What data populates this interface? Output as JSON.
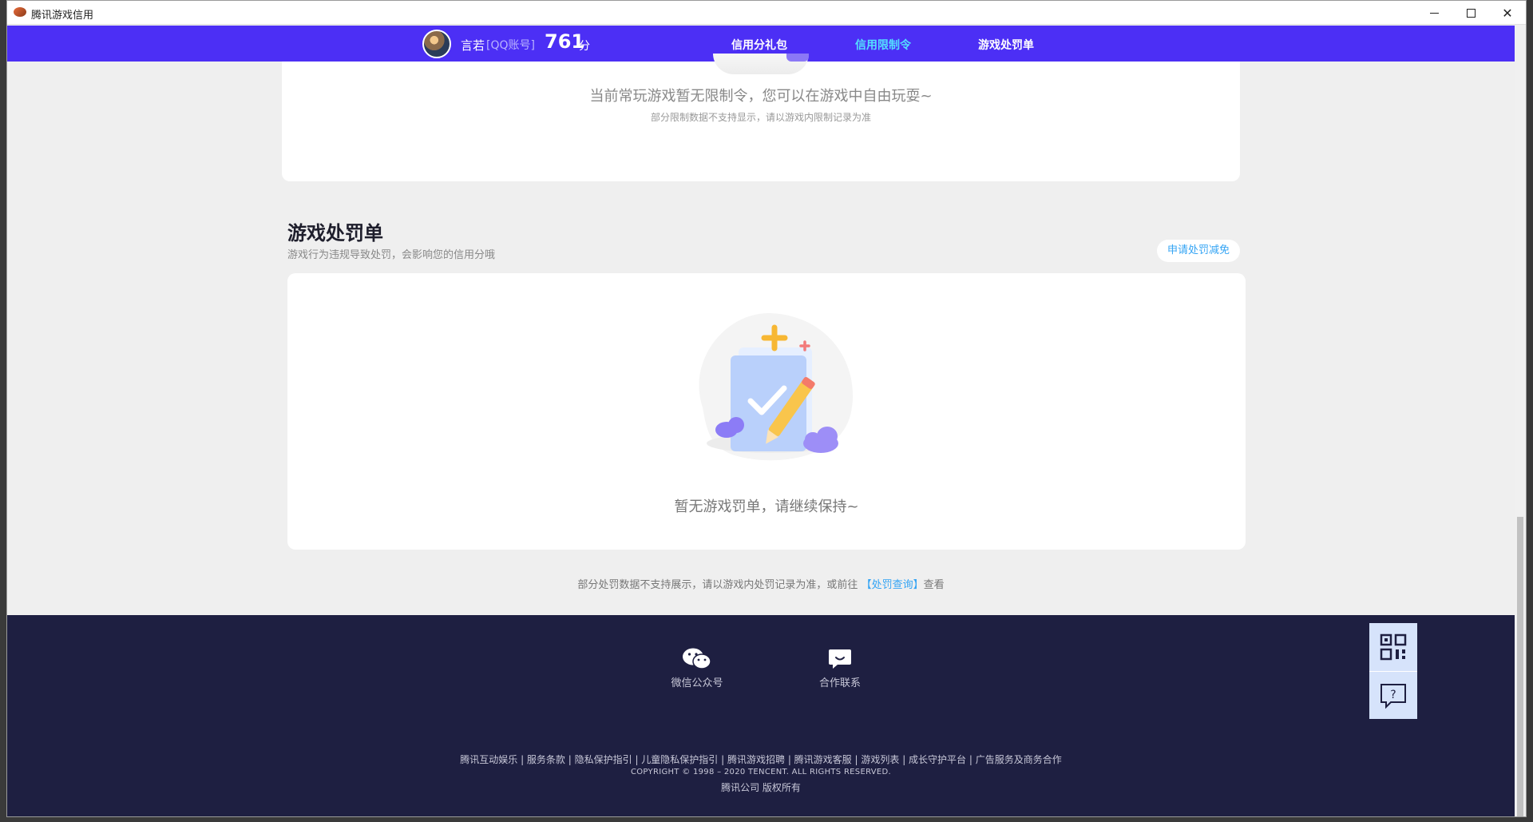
{
  "window": {
    "title": "腾讯游戏信用"
  },
  "header": {
    "username": "言若",
    "account_type": "[QQ账号]",
    "score": "761",
    "score_unit": "分",
    "nav": [
      {
        "label": "信用分礼包",
        "active": false
      },
      {
        "label": "信用限制令",
        "active": true
      },
      {
        "label": "游戏处罚单",
        "active": false
      }
    ]
  },
  "restriction": {
    "message": "当前常玩游戏暂无限制令，您可以在游戏中自由玩耍~",
    "note": "部分限制数据不支持显示，请以游戏内限制记录为准"
  },
  "penalty": {
    "title": "游戏处罚单",
    "subtitle": "游戏行为违规导致处罚，会影响您的信用分哦",
    "appeal_button": "申请处罚减免",
    "empty_message": "暂无游戏罚单，请继续保持~",
    "footer_note_prefix": "部分处罚数据不支持展示，请以游戏内处罚记录为准，或前往",
    "footer_note_link": "【处罚查询】",
    "footer_note_suffix": "查看"
  },
  "footer": {
    "wechat_label": "微信公众号",
    "contact_label": "合作联系",
    "links": [
      "腾讯互动娱乐",
      "服务条款",
      "隐私保护指引",
      "儿童隐私保护指引",
      "腾讯游戏招聘",
      "腾讯游戏客服",
      "游戏列表",
      "成长守护平台",
      "广告服务及商务合作"
    ],
    "copyright": "COPYRIGHT © 1998 – 2020 TENCENT. ALL RIGHTS RESERVED.",
    "rights": "腾讯公司 版权所有"
  },
  "colors": {
    "nav_bg": "#4c2ff5",
    "nav_active": "#54e0ff",
    "footer_bg": "#1e1f41",
    "link": "#34a4f4"
  },
  "icons": [
    "app-icon",
    "minimize-icon",
    "maximize-icon",
    "close-icon",
    "wechat-icon",
    "chat-icon",
    "qr-code-icon",
    "help-icon"
  ]
}
